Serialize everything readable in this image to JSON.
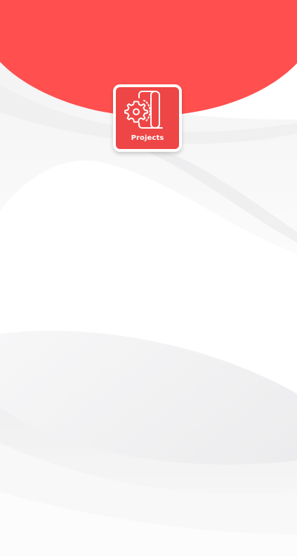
{
  "colors": {
    "accent": "#ff4f4f",
    "tile_background": "#ee4646",
    "tile_border": "#ffffff",
    "background": "#f6f6f7"
  },
  "tiles": [
    {
      "label": "Projects",
      "icon": "project-settings-icon"
    }
  ]
}
